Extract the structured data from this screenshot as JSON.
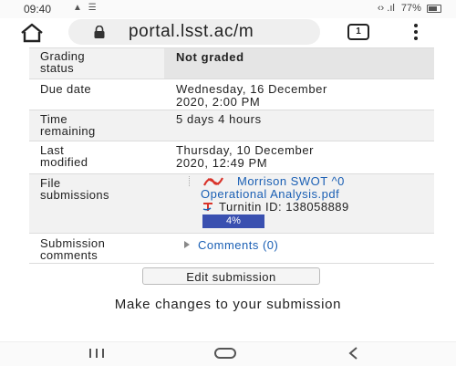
{
  "status_bar": {
    "time": "09:40",
    "battery": "77%",
    "icons": [
      "lock-icon",
      "message-icon",
      "signal-icon",
      "battery-icon"
    ]
  },
  "browser": {
    "url": "portal.lsst.ac/m",
    "tab_count": "1"
  },
  "submission": {
    "rows": [
      {
        "label_line1": "Grading",
        "label_line2": "status",
        "value": "Not graded"
      },
      {
        "label_line1": "Due date",
        "value_line1": "Wednesday, 16 December",
        "value_line2": "2020, 2:00 PM"
      },
      {
        "label_line1": "Time",
        "label_line2": "remaining",
        "value": "5 days 4 hours"
      },
      {
        "label_line1": "Last",
        "label_line2": "modified",
        "value_line1": "Thursday, 10 December",
        "value_line2": "2020, 12:49 PM"
      },
      {
        "label_line1": "File",
        "label_line2": "submissions"
      },
      {
        "label_line1": "Submission",
        "label_line2": "comments"
      }
    ],
    "file": {
      "name_line1": "Morrison SWOT ^0",
      "name_line2": "Operational Analysis.pdf",
      "turnitin": "Turnitin ID: 138058889",
      "similarity": "4%",
      "similarity_value": 4
    },
    "comments_link": "Comments (0)"
  },
  "actions": {
    "edit_button": "Edit submission",
    "helper_text": "Make changes to your submission"
  },
  "colors": {
    "link": "#1a5fb4",
    "progress": "#3a50b0",
    "pdf_red": "#d9342b"
  }
}
